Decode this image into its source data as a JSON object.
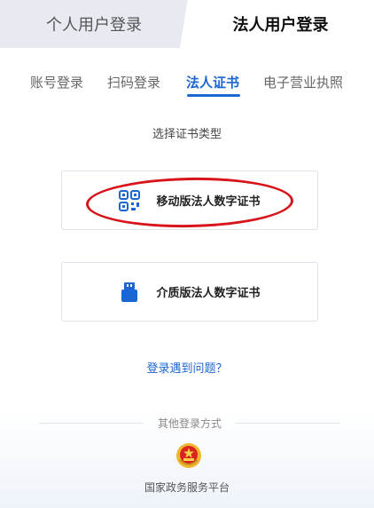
{
  "top_tabs": {
    "personal_label": "个人用户登录",
    "legal_label": "法人用户登录"
  },
  "sub_tabs": [
    {
      "label": "账号登录",
      "active": false
    },
    {
      "label": "扫码登录",
      "active": false
    },
    {
      "label": "法人证书",
      "active": true
    },
    {
      "label": "电子营业执照",
      "active": false
    }
  ],
  "section_title": "选择证书类型",
  "cards": {
    "mobile": {
      "label": "移动版法人数字证书",
      "icon": "qr-code-icon"
    },
    "media": {
      "label": "介质版法人数字证书",
      "icon": "usb-key-icon"
    }
  },
  "help_link": "登录遇到问题？",
  "other_login": {
    "heading": "其他登录方式",
    "platform_label": "国家政务服务平台",
    "platform_icon": "national-emblem-icon"
  },
  "colors": {
    "accent": "#1a66d2",
    "annotation": "#d7141a"
  }
}
